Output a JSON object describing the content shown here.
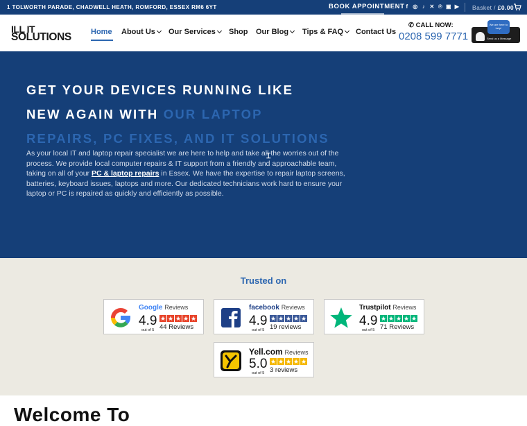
{
  "topbar": {
    "address": "1 TOLWORTH PARADE, CHADWELL HEATH, ROMFORD, ESSEX RM6 6YT",
    "book": "BOOK APPOINTMENT",
    "socials": [
      "facebook-icon",
      "instagram-icon",
      "tiktok-icon",
      "x-icon",
      "pinterest-icon",
      "linkedin-icon",
      "youtube-icon"
    ],
    "basket_label": "Basket /",
    "basket_amount": "£0.00"
  },
  "logo": {
    "line1": "ILL IT",
    "line2": "SOLUTIONS"
  },
  "nav": {
    "items": [
      {
        "label": "Home",
        "active": true,
        "has_menu": false
      },
      {
        "label": "About Us",
        "active": false,
        "has_menu": true
      },
      {
        "label": "Our Services",
        "active": false,
        "has_menu": true
      },
      {
        "label": "Shop",
        "active": false,
        "has_menu": false
      },
      {
        "label": "Our Blog",
        "active": false,
        "has_menu": true
      },
      {
        "label": "Tips & FAQ",
        "active": false,
        "has_menu": true
      },
      {
        "label": "Contact Us",
        "active": false,
        "has_menu": false
      }
    ]
  },
  "contact": {
    "call_label": "CALL NOW:",
    "phone": "0208 599 7771"
  },
  "bubble": {
    "top_text": "We are here to help!",
    "bottom_text": "Send us a Message"
  },
  "hero": {
    "title_white": "GET YOUR DEVICES RUNNING LIKE NEW AGAIN WITH ",
    "title_highlight": "OUR LAPTOP REPAIRS, PC FIXES, AND IT SOLUTIONS",
    "body_before": "As your local IT and laptop repair specialist we are here to help and take all the worries out of the process. We provide local computer repairs & IT support from a friendly and approachable team, taking on all of your ",
    "body_link": "PC & laptop repairs",
    "body_after": " in Essex. We have the expertise to repair laptop screens, batteries, keyboard issues, laptops and more. Our dedicated technicians work hard to ensure your laptop or PC is repaired as quickly and efficiently as possible."
  },
  "trusted": {
    "title": "Trusted on",
    "cards": [
      {
        "brand": "Google",
        "suffix": "Reviews",
        "score": "4.9",
        "out_of": "out of 5",
        "count": "44 Reviews",
        "star_color": "#e8442b",
        "rating": 4.9
      },
      {
        "brand": "facebook",
        "suffix": "Reviews",
        "score": "4.9",
        "out_of": "out of 5",
        "count": "19 reviews",
        "star_color": "#3b5998",
        "rating": 4.9
      },
      {
        "brand": "Trustpilot",
        "suffix": "Reviews",
        "score": "4.9",
        "out_of": "out of 5",
        "count": "71 Reviews",
        "star_color": "#00b67a",
        "rating": 4.9
      },
      {
        "brand": "Yell.com",
        "suffix": "Reviews",
        "score": "5.0",
        "out_of": "out of 5",
        "count": "3   reviews",
        "star_color": "#f5b800",
        "rating": 5.0
      }
    ]
  },
  "welcome": {
    "title": "Welcome To"
  },
  "colors": {
    "navy": "#153f78",
    "accent": "#2c66b0",
    "band": "#eceae2"
  }
}
